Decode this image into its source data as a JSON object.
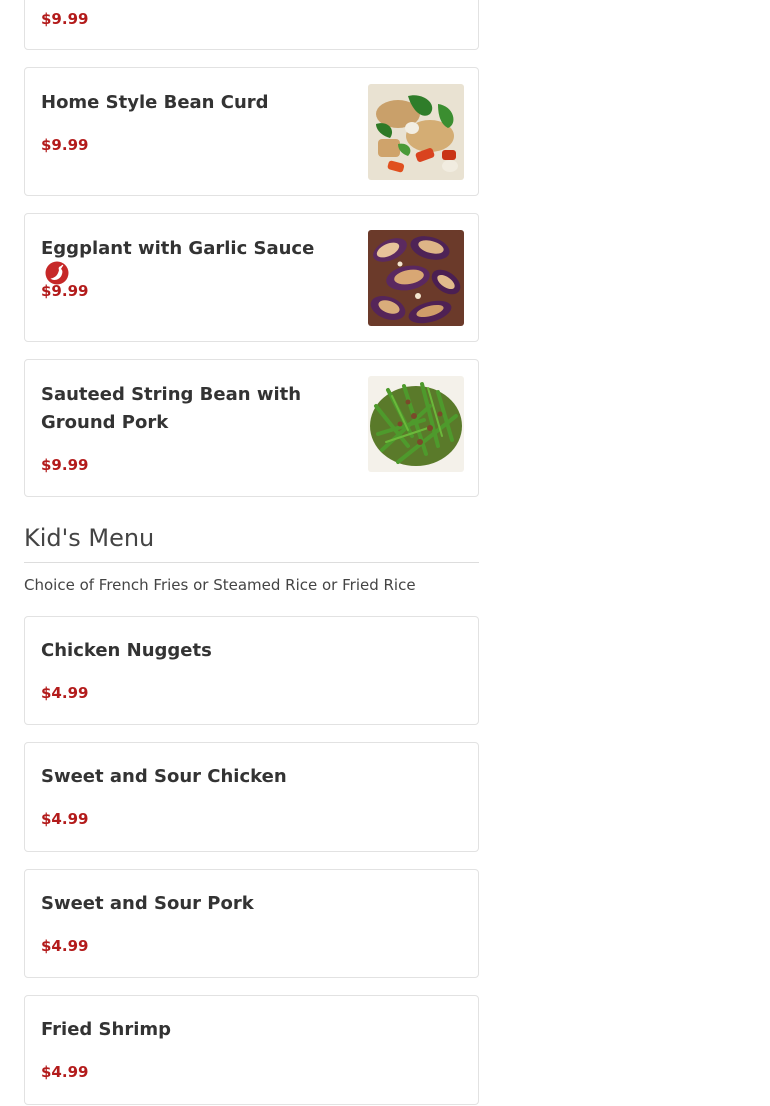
{
  "top_items": [
    {
      "price": "$9.99"
    },
    {
      "name": "Home Style Bean Curd",
      "price": "$9.99",
      "image": "bean-curd-photo"
    },
    {
      "name": "Eggplant with Garlic Sauce",
      "price": "$9.99",
      "image": "eggplant-photo",
      "spicy_icon": "chili-pepper-icon"
    },
    {
      "name": "Sauteed String Bean with Ground Pork",
      "price": "$9.99",
      "image": "string-bean-photo"
    }
  ],
  "kids_menu": {
    "title": "Kid's Menu",
    "description": "Choice of French Fries or Steamed Rice or Fried Rice",
    "items": [
      {
        "name": "Chicken Nuggets",
        "price": "$4.99"
      },
      {
        "name": "Sweet and Sour Chicken",
        "price": "$4.99"
      },
      {
        "name": "Sweet and Sour Pork",
        "price": "$4.99"
      },
      {
        "name": "Fried Shrimp",
        "price": "$4.99"
      }
    ]
  },
  "colors": {
    "price": "#b31b1b",
    "spicy": "#c62828",
    "card_border": "#e2e2e2"
  }
}
